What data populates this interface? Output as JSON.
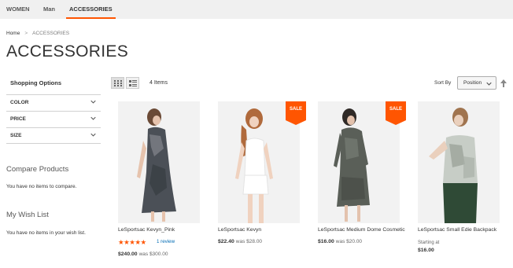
{
  "nav": {
    "items": [
      {
        "label": "WOMEN"
      },
      {
        "label": "Man"
      },
      {
        "label": "ACCESSORIES"
      }
    ]
  },
  "breadcrumb": {
    "home": "Home",
    "separator": ">",
    "current": "ACCESSORIES"
  },
  "page_title": "ACCESSORIES",
  "sidebar": {
    "title": "Shopping Options",
    "filters": [
      {
        "label": "COLOR"
      },
      {
        "label": "PRICE"
      },
      {
        "label": "SIZE"
      }
    ],
    "compare": {
      "title": "Compare Products",
      "text": "You have no items to compare."
    },
    "wishlist": {
      "title": "My Wish List",
      "text": "You have no items in your wish list."
    }
  },
  "toolbar": {
    "count": "4 Items",
    "sort_label": "Sort By",
    "sort_value": "Position"
  },
  "products": [
    {
      "name": "LeSportsac Kevyn_Pink",
      "price": "$240.00",
      "old_price": "was $300.00",
      "rating": "★★★★★",
      "reviews": "1 review"
    },
    {
      "name": "LeSportsac Kevyn",
      "price": "$22.40",
      "old_price": "was $28.00"
    },
    {
      "name": "LeSportsac Medium Dome Cosmetic",
      "price": "$16.00",
      "old_price": "was $20.00"
    },
    {
      "name": "LeSportsac Small Edie Backpack",
      "starting": "Starting at",
      "price": "$16.00"
    }
  ],
  "sale_label": "SALE",
  "colors": {
    "accent": "#ff5501",
    "link": "#006bb4",
    "nav_bg": "#f0f0f0"
  }
}
